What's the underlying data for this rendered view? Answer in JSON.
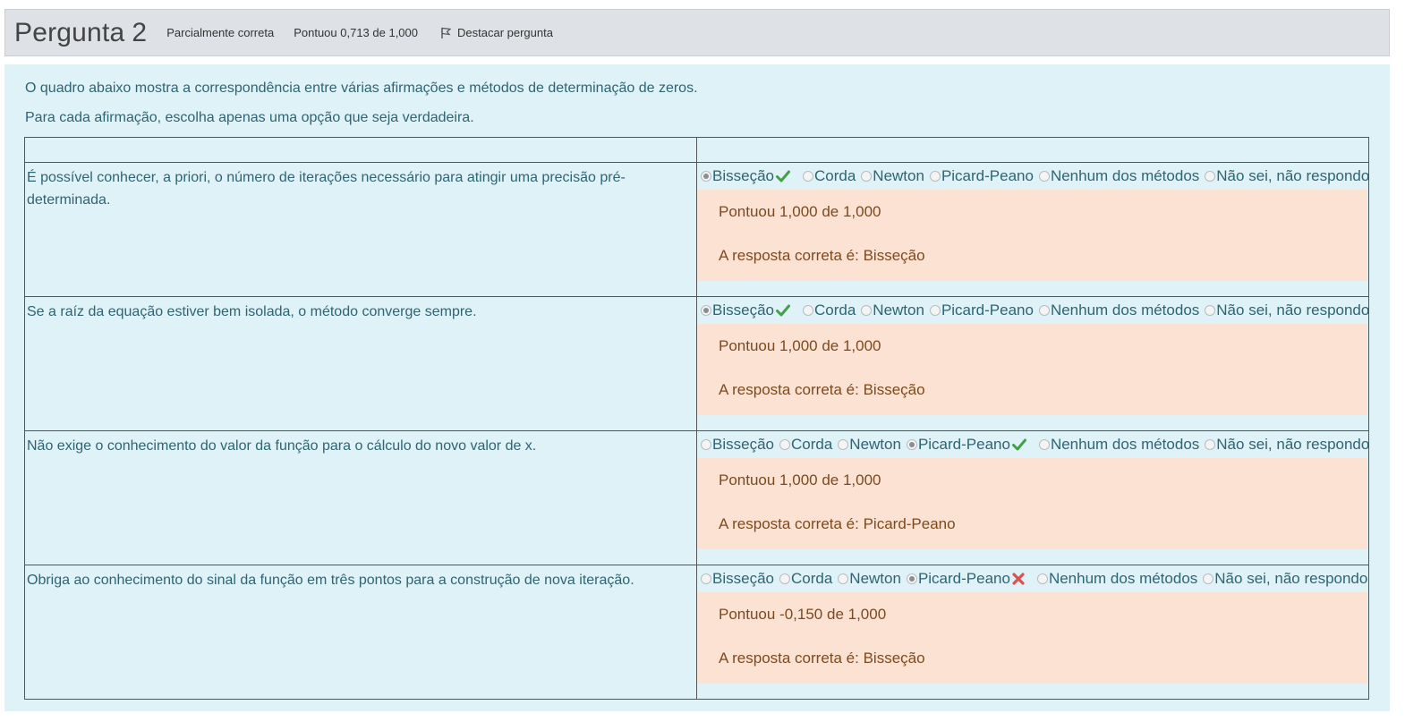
{
  "header": {
    "title_word": "Pergunta",
    "number": "2",
    "state": "Parcialmente correta",
    "grade": "Pontuou 0,713 de 1,000",
    "flag_label": "Destacar pergunta",
    "flag_icon": "flag-icon"
  },
  "question": {
    "intro": "O quadro abaixo mostra a correspondência entre várias afirmações e métodos de determinação de zeros.",
    "instruction": "Para cada afirmação, escolha apenas uma opção que seja verdadeira."
  },
  "options": [
    "Bisseção",
    "Corda",
    "Newton",
    "Picard-Peano",
    "Nenhum dos métodos",
    "Não sei, não respondo"
  ],
  "rows": [
    {
      "stem": "É possível conhecer, a priori, o número de iterações necessário para atingir uma precisão pré-determinada.",
      "selected": "Bisseção",
      "result": "correct",
      "score": "Pontuou 1,000 de 1,000",
      "right_answer": "A resposta correta é: Bisseção"
    },
    {
      "stem": "Se a raíz da equação estiver bem isolada, o método converge sempre.",
      "selected": "Bisseção",
      "result": "correct",
      "score": "Pontuou 1,000 de 1,000",
      "right_answer": "A resposta correta é: Bisseção"
    },
    {
      "stem": "Não exige o conhecimento do valor da função para o cálculo do novo valor de x.",
      "selected": "Picard-Peano",
      "result": "correct",
      "score": "Pontuou 1,000 de 1,000",
      "right_answer": "A resposta correta é: Picard-Peano"
    },
    {
      "stem": "Obriga ao conhecimento do sinal da função em três pontos para a construção de nova iteração.",
      "selected": "Picard-Peano",
      "result": "incorrect",
      "score": "Pontuou -0,150 de 1,000",
      "right_answer": "A resposta correta é: Bisseção"
    }
  ],
  "colors": {
    "header_bg": "#dee2e6",
    "content_bg": "#def2f8",
    "feedback_bg": "#fce2d2",
    "correct": "#43a047",
    "incorrect": "#d9534f"
  }
}
